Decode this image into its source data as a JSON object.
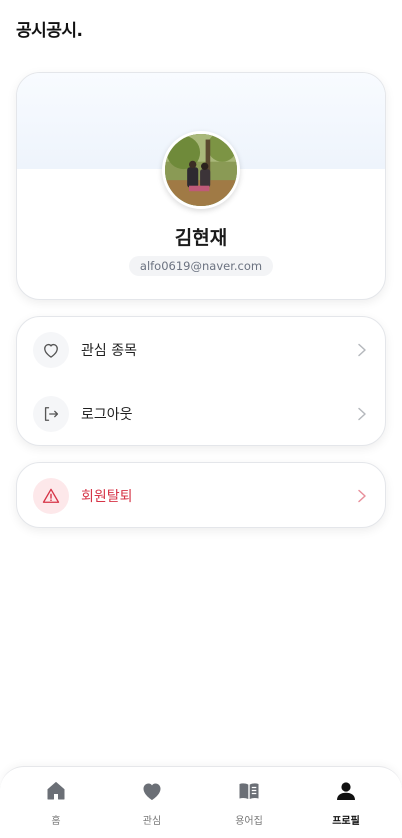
{
  "app": {
    "logo": "공시공시."
  },
  "profile": {
    "name": "김현재",
    "email": "alfo0619@naver.com"
  },
  "menu": {
    "items": [
      {
        "label": "관심 종목",
        "icon": "heart-icon"
      },
      {
        "label": "로그아웃",
        "icon": "logout-icon"
      }
    ],
    "danger": {
      "label": "회원탈퇴",
      "icon": "warning-icon"
    }
  },
  "nav": {
    "items": [
      {
        "label": "홈",
        "icon": "home-icon"
      },
      {
        "label": "관심",
        "icon": "heart-icon"
      },
      {
        "label": "용어집",
        "icon": "book-icon"
      },
      {
        "label": "프로필",
        "icon": "user-icon"
      }
    ],
    "active": "프로필"
  },
  "colors": {
    "danger": "#d63447",
    "danger_bg": "#fde8ea",
    "nav_icon": "#6b6f76",
    "nav_active": "#111111"
  }
}
